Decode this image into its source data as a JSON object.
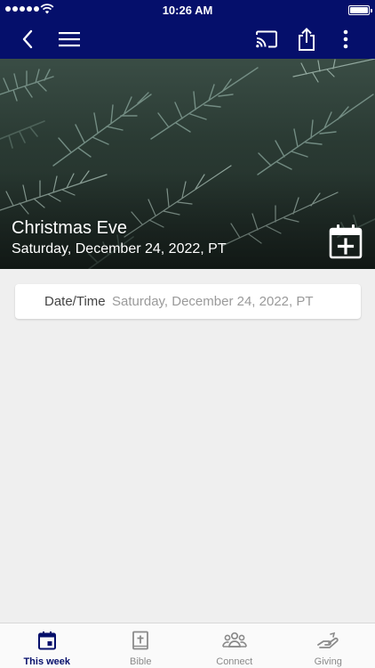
{
  "status_bar": {
    "time": "10:26 AM"
  },
  "event": {
    "title": "Christmas Eve",
    "subtitle": "Saturday, December 24, 2022, PT"
  },
  "details": {
    "label": "Date/Time",
    "value": "Saturday, December 24, 2022, PT"
  },
  "tabs": [
    {
      "label": "This week",
      "icon": "calendar-icon",
      "active": true
    },
    {
      "label": "Bible",
      "icon": "bible-icon",
      "active": false
    },
    {
      "label": "Connect",
      "icon": "people-icon",
      "active": false
    },
    {
      "label": "Giving",
      "icon": "giving-hand-icon",
      "active": false
    }
  ],
  "colors": {
    "brand": "#050f6b",
    "tab_inactive": "#8a8a8a",
    "background": "#efefef"
  }
}
